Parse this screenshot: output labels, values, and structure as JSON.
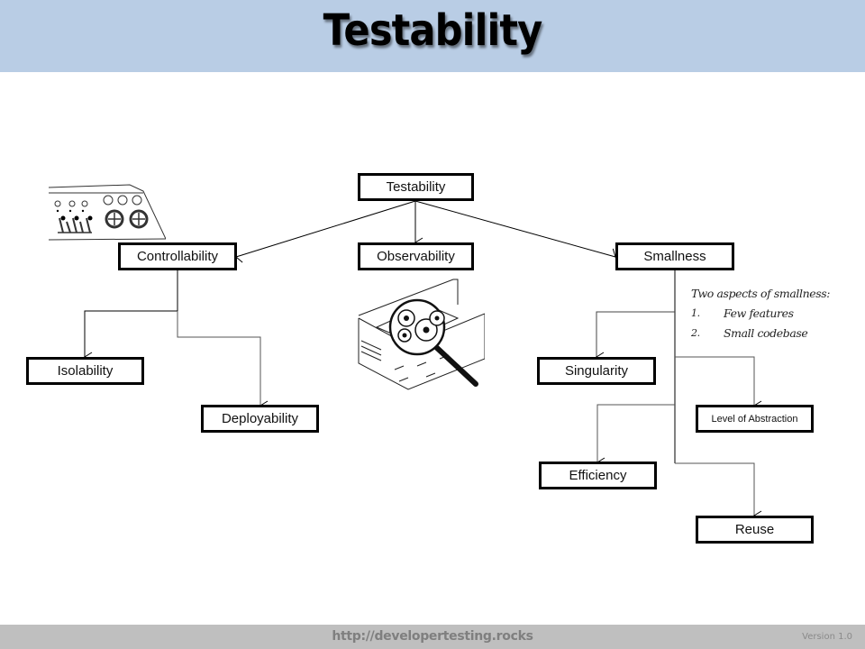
{
  "header": {
    "title": "Testability",
    "background": "#b9cde5"
  },
  "nodes": {
    "root": "Testability",
    "controllability": "Controllability",
    "observability": "Observability",
    "smallness": "Smallness",
    "isolability": "Isolability",
    "deployability": "Deployability",
    "singularity": "Singularity",
    "level_of_abstraction": "Level of Abstraction",
    "efficiency": "Efficiency",
    "reuse": "Reuse"
  },
  "note": {
    "heading": "Two aspects of smallness:",
    "items": [
      {
        "num": "1.",
        "text": "Few features"
      },
      {
        "num": "2.",
        "text": "Small codebase"
      }
    ]
  },
  "illustrations": {
    "control_panel": "control-panel-icon",
    "magnified_gears": "magnifier-gears-icon"
  },
  "footer": {
    "url": "http://developertesting.rocks",
    "version": "Version 1.0",
    "background": "#bfbfbf"
  }
}
